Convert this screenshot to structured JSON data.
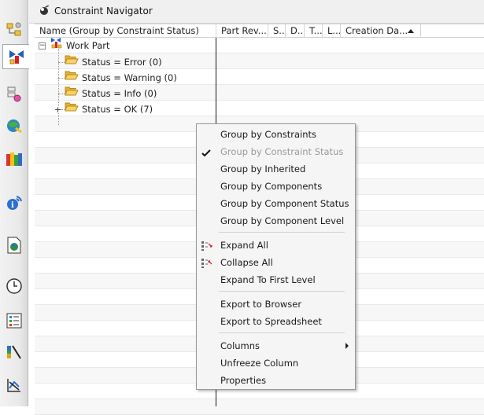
{
  "navigator": {
    "title": "Constraint Navigator",
    "icon": "navigator-icon"
  },
  "resource_bar": {
    "items": [
      {
        "name": "assembly-navigator-icon"
      },
      {
        "name": "constraint-navigator-icon",
        "active": true
      },
      {
        "name": "part-navigator-icon"
      },
      {
        "name": "reuse-library-icon"
      },
      {
        "name": "hd3d-tools-icon"
      },
      {
        "name": "web-browser-icon"
      },
      {
        "name": "history-icon"
      },
      {
        "name": "system-materials-icon"
      },
      {
        "name": "process-studio-icon"
      },
      {
        "name": "roles-icon"
      },
      {
        "name": "system-scenes-icon"
      }
    ]
  },
  "columns": [
    {
      "label": "Name (Group by Constraint Status)"
    },
    {
      "label": "Part Rev..."
    },
    {
      "label": "S..."
    },
    {
      "label": "D..."
    },
    {
      "label": "T..."
    },
    {
      "label": "L..."
    },
    {
      "label": "Creation Da..."
    }
  ],
  "tree": {
    "root": {
      "label": "Work Part"
    },
    "groups": [
      {
        "label": "Status = Error (0)"
      },
      {
        "label": "Status = Warning (0)"
      },
      {
        "label": "Status = Info (0)"
      },
      {
        "label": "Status = OK (7)"
      }
    ]
  },
  "context_menu": {
    "items": [
      {
        "label": "Group by Constraints"
      },
      {
        "label": "Group by Constraint Status"
      },
      {
        "label": "Group by Inherited"
      },
      {
        "label": "Group by Components"
      },
      {
        "label": "Group by Component Status"
      },
      {
        "label": "Group by Component Level"
      },
      {
        "label": "Expand All"
      },
      {
        "label": "Collapse All"
      },
      {
        "label": "Expand To First Level"
      },
      {
        "label": "Export to Browser"
      },
      {
        "label": "Export to Spreadsheet"
      },
      {
        "label": "Columns"
      },
      {
        "label": "Unfreeze Column"
      },
      {
        "label": "Properties"
      }
    ]
  },
  "colors": {
    "folder": "#f3c74b",
    "folder_border": "#c99a1e",
    "menu_bg": "#f5f5f5",
    "disabled_text": "#9a9a9a"
  }
}
